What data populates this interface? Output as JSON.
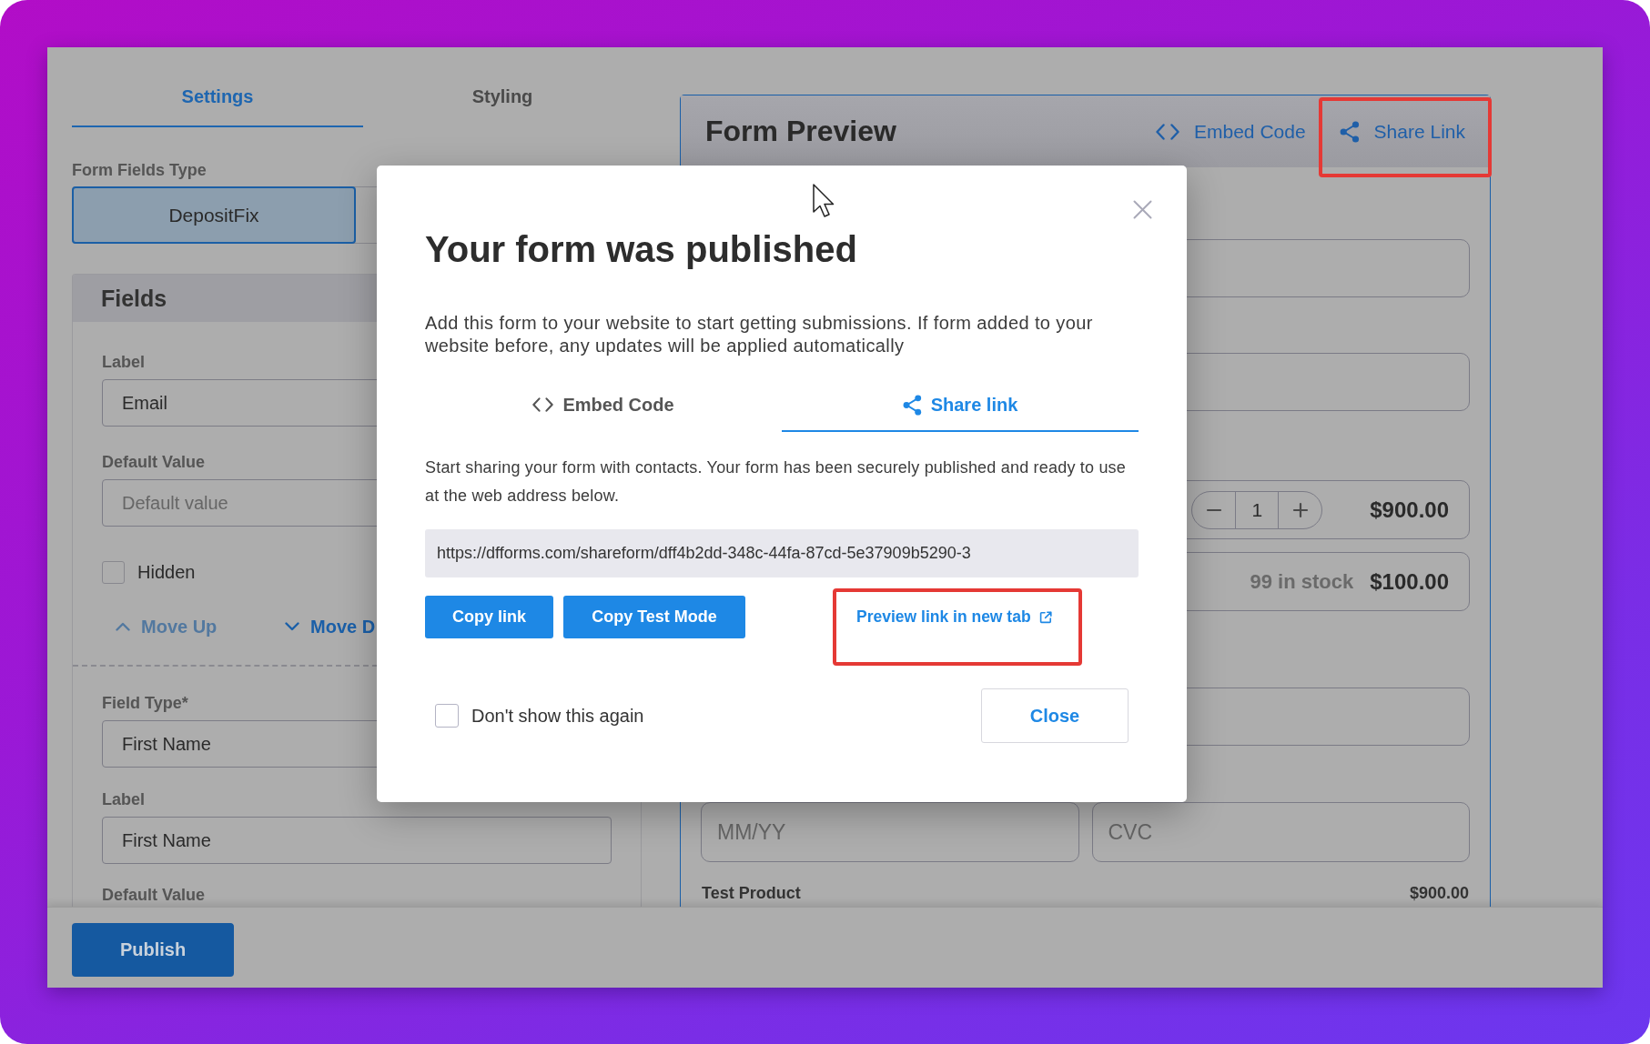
{
  "settings_panel": {
    "tabs": [
      {
        "label": "Settings",
        "selected": true
      },
      {
        "label": "Styling",
        "selected": false
      }
    ],
    "form_fields_type": {
      "label": "Form Fields Type",
      "options": [
        {
          "label": "DepositFix",
          "selected": true
        }
      ]
    },
    "fields_panel": {
      "title": "Fields",
      "groups": [
        {
          "items": [
            {
              "kind": "input",
              "label": "Label",
              "value": "Email"
            },
            {
              "kind": "input",
              "label": "Default Value",
              "placeholder": "Default value"
            },
            {
              "kind": "checkbox",
              "label": "Hidden",
              "checked": false
            },
            {
              "kind": "actions",
              "actions": [
                {
                  "kind": "up",
                  "label": "Move Up",
                  "disabled": true
                },
                {
                  "kind": "down",
                  "label": "Move D",
                  "disabled": false
                }
              ]
            }
          ]
        },
        {
          "items": [
            {
              "kind": "input",
              "label": "Field Type*",
              "value": "First Name"
            },
            {
              "kind": "input",
              "label": "Label",
              "value": "First Name"
            },
            {
              "kind": "label",
              "label": "Default Value"
            }
          ]
        }
      ]
    }
  },
  "form_preview": {
    "title": "Form Preview",
    "actions": [
      {
        "kind": "embed",
        "label": "Embed Code",
        "highlighted": false
      },
      {
        "kind": "share",
        "label": "Share Link",
        "highlighted": true
      }
    ],
    "rows": [
      {
        "kind": "input"
      },
      {
        "kind": "input"
      },
      {
        "kind": "product",
        "quantity": "1",
        "price": "$900.00"
      },
      {
        "kind": "product",
        "stock": "99 in stock",
        "price": "$100.00"
      },
      {
        "kind": "input"
      },
      {
        "kind": "split",
        "fields": [
          {
            "placeholder": "MM/YY"
          },
          {
            "placeholder": "CVC"
          }
        ]
      },
      {
        "kind": "summary",
        "label": "Test Product",
        "amount": "$900.00"
      }
    ]
  },
  "dialog": {
    "title": "Your form was published",
    "description": "Add this form to your website to start getting submissions. If form added to your website before, any updates will be applied automatically",
    "tabs": [
      {
        "kind": "embed",
        "label": "Embed Code",
        "selected": false
      },
      {
        "kind": "share",
        "label": "Share link",
        "selected": true
      }
    ],
    "instructions": "Start sharing your form with contacts. Your form has been securely published and ready to use at the web address below.",
    "url": "https://dfforms.com/shareform/dff4b2dd-348c-44fa-87cd-5e37909b5290-3",
    "buttons": [
      "Copy link",
      "Copy Test Mode"
    ],
    "preview_link": {
      "label": "Preview link in new tab",
      "highlighted": true
    },
    "dont_show_again": {
      "label": "Don't show this again",
      "checked": false
    },
    "close_button": "Close"
  },
  "footer": {
    "publish_button": "Publish"
  }
}
